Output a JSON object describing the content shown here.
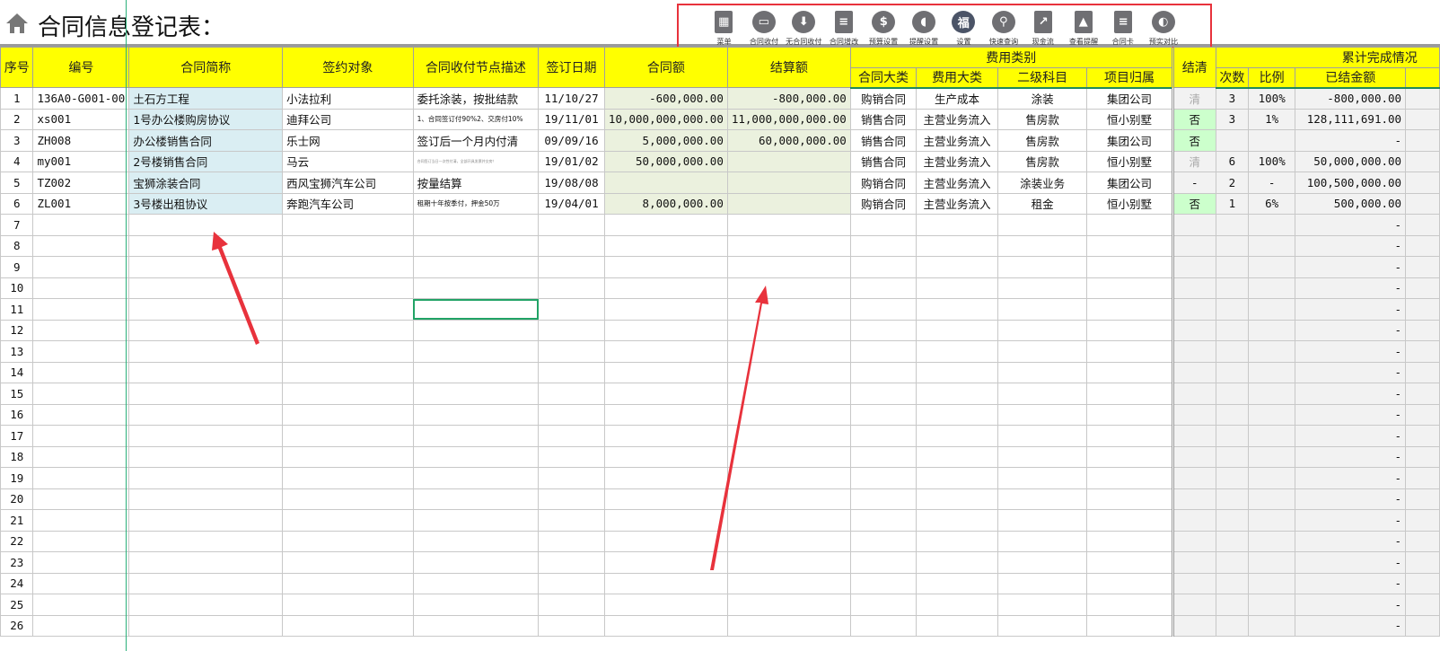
{
  "title": "合同信息登记表：",
  "toolbar": [
    {
      "icon": "grid-menu-icon",
      "label": "菜单"
    },
    {
      "icon": "wallet-icon",
      "label": "合同收付"
    },
    {
      "icon": "download-circle-icon",
      "label": "无合同收付"
    },
    {
      "icon": "document-icon",
      "label": "合同增改"
    },
    {
      "icon": "money-bag-icon",
      "label": "预算设置"
    },
    {
      "icon": "speaker-icon",
      "label": "提醒设置"
    },
    {
      "icon": "gear-icon",
      "label": "设置"
    },
    {
      "icon": "search-icon",
      "label": "快速查询"
    },
    {
      "icon": "chart-icon",
      "label": "现金流"
    },
    {
      "icon": "bell-icon",
      "label": "查看提醒"
    },
    {
      "icon": "card-icon",
      "label": "合同卡"
    },
    {
      "icon": "contrast-icon",
      "label": "预实对比"
    }
  ],
  "headers": {
    "seq": "序号",
    "code": "编号",
    "name": "合同简称",
    "party": "签约对象",
    "desc": "合同收付节点描述",
    "date": "签订日期",
    "amount": "合同额",
    "settle": "结算额",
    "group": "费用类别",
    "ctype": "合同大类",
    "etype": "费用大类",
    "sub": "二级科目",
    "proj": "项目归属",
    "cleared": "结清",
    "cum": "累计完成情况",
    "times": "次数",
    "ratio": "比例",
    "paid": "已结金额"
  },
  "rows": [
    {
      "seq": "1",
      "code": "136A0-G001-00",
      "name": "土石方工程",
      "party": "小法拉利",
      "desc": "委托涂装，按批结款",
      "date": "11/10/27",
      "amount": "-600,000.00",
      "settle": "-800,000.00",
      "ctype": "购销合同",
      "etype": "生产成本",
      "sub": "涂装",
      "proj": "集团公司",
      "cleared": "清",
      "times": "3",
      "ratio": "100%",
      "paid": "-800,000.00"
    },
    {
      "seq": "2",
      "code": "xs001",
      "name": "1号办公楼购房协议",
      "party": "迪拜公司",
      "desc": "1、合同签订付90%2、交房付10%",
      "date": "19/11/01",
      "amount": "10,000,000,000.00",
      "settle": "11,000,000,000.00",
      "ctype": "销售合同",
      "etype": "主营业务流入",
      "sub": "售房款",
      "proj": "恒小别墅",
      "cleared": "否",
      "times": "3",
      "ratio": "1%",
      "paid": "128,111,691.00"
    },
    {
      "seq": "3",
      "code": "ZH008",
      "name": "办公楼销售合同",
      "party": "乐士网",
      "desc": "签订后一个月内付清",
      "date": "09/09/16",
      "amount": "5,000,000.00",
      "settle": "60,000,000.00",
      "ctype": "销售合同",
      "etype": "主营业务流入",
      "sub": "售房款",
      "proj": "集团公司",
      "cleared": "否",
      "times": "",
      "ratio": "",
      "paid": "-"
    },
    {
      "seq": "4",
      "code": "my001",
      "name": "2号楼销售合同",
      "party": "马云",
      "desc": "合同签订当日一次性付清，全部开具发票并交房！",
      "date": "19/01/02",
      "amount": "50,000,000.00",
      "settle": "",
      "ctype": "销售合同",
      "etype": "主营业务流入",
      "sub": "售房款",
      "proj": "恒小别墅",
      "cleared": "清",
      "times": "6",
      "ratio": "100%",
      "paid": "50,000,000.00"
    },
    {
      "seq": "5",
      "code": "TZ002",
      "name": "宝狮涂装合同",
      "party": "西风宝狮汽车公司",
      "desc": "按量结算",
      "date": "19/08/08",
      "amount": "",
      "settle": "",
      "ctype": "购销合同",
      "etype": "主营业务流入",
      "sub": "涂装业务",
      "proj": "集团公司",
      "cleared": "-",
      "times": "2",
      "ratio": "-",
      "paid": "100,500,000.00"
    },
    {
      "seq": "6",
      "code": "ZL001",
      "name": "3号楼出租协议",
      "party": "奔跑汽车公司",
      "desc": "租期十年按季付，押金50万",
      "date": "19/04/01",
      "amount": "8,000,000.00",
      "settle": "",
      "ctype": "购销合同",
      "etype": "主营业务流入",
      "sub": "租金",
      "proj": "恒小别墅",
      "cleared": "否",
      "times": "1",
      "ratio": "6%",
      "paid": "500,000.00"
    }
  ],
  "empty_rows": [
    "7",
    "8",
    "9",
    "10",
    "11",
    "12",
    "13",
    "14",
    "15",
    "16",
    "17",
    "18",
    "19",
    "20",
    "21",
    "22",
    "23",
    "24",
    "25",
    "26"
  ],
  "empty_paid": "-",
  "colors": {
    "header": "#ffff00",
    "name_col": "#daeef3",
    "amount_col": "#ebf1de",
    "not_cleared": "#ccffcc",
    "annotation": "#e8323c"
  }
}
